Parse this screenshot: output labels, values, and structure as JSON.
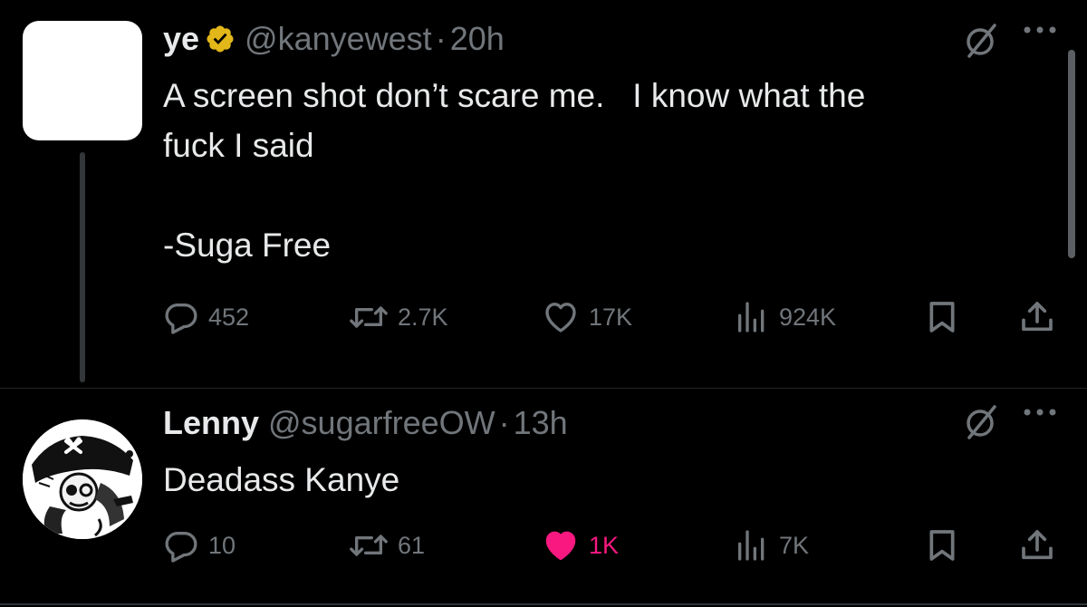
{
  "tweets": [
    {
      "name": "ye",
      "handle": "@kanyewest",
      "separator": "·",
      "time": "20h",
      "verified": true,
      "text": "A screen shot don’t scare me.   I know what the\nfuck I said\n\n-Suga Free",
      "replies": "452",
      "retweets": "2.7K",
      "likes": "17K",
      "views": "924K",
      "liked": false
    },
    {
      "name": "Lenny",
      "handle": "@sugarfreeOW",
      "separator": "·",
      "time": "13h",
      "verified": false,
      "text": "Deadass Kanye",
      "replies": "10",
      "retweets": "61",
      "likes": "1K",
      "views": "7K",
      "liked": true
    }
  ],
  "icons": {
    "reply": "speech-bubble-icon",
    "retweet": "retweet-arrows-icon",
    "like": "heart-icon",
    "views": "bar-chart-icon",
    "bookmark": "bookmark-icon",
    "share": "share-upload-icon",
    "mute": "mute-slash-circle-icon",
    "more": "more-dots-icon",
    "verified": "verified-badge-icon"
  },
  "colors": {
    "background": "#000000",
    "text": "#e7e9ea",
    "muted": "#71767b",
    "like_active": "#f91880",
    "verified_gold": "#e2b719"
  }
}
